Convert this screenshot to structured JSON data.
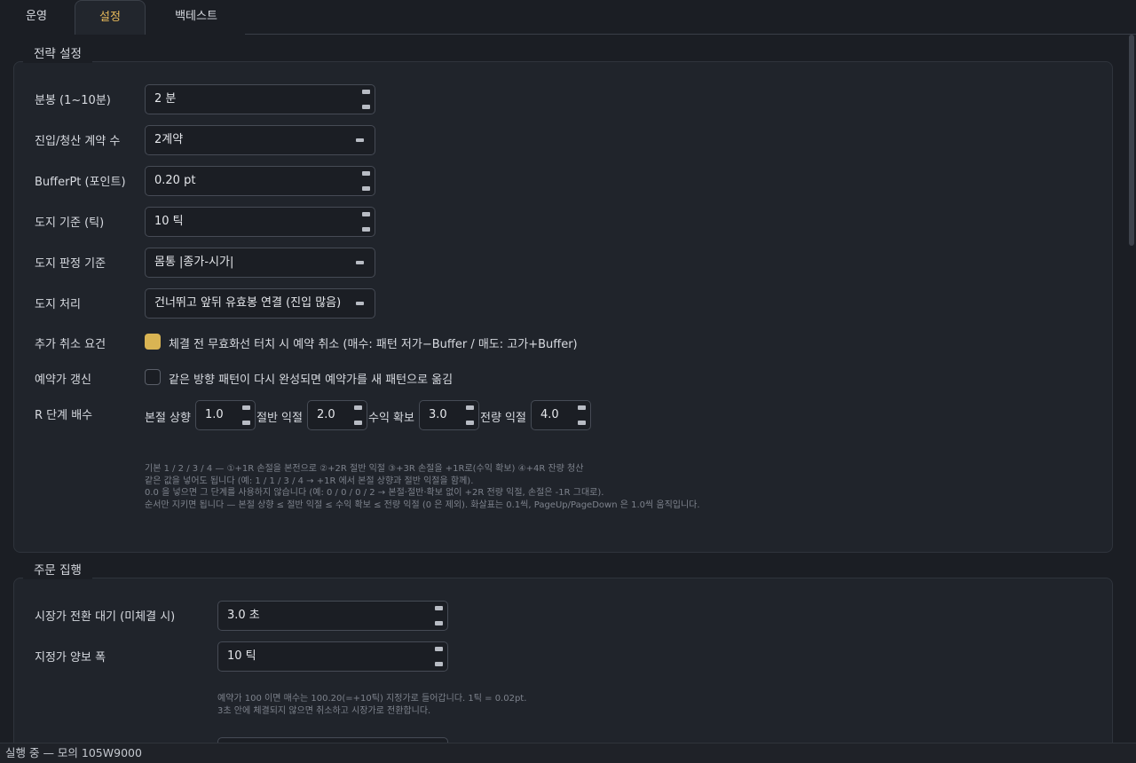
{
  "tabs": [
    {
      "label": "운영"
    },
    {
      "label": "설정"
    },
    {
      "label": "백테스트"
    }
  ],
  "strategy": {
    "title": "전략 설정",
    "bar": {
      "label": "분봉 (1~10분)",
      "value": "2 분"
    },
    "contracts": {
      "label": "진입/청산 계약 수",
      "value": "2계약"
    },
    "buffer": {
      "label": "BufferPt (포인트)",
      "value": "0.20 pt"
    },
    "doji_ticks": {
      "label": "도지 기준 (틱)",
      "value": "10 틱"
    },
    "doji_basis": {
      "label": "도지 판정 기준",
      "value": "몸통 |종가-시가|"
    },
    "doji_handling": {
      "label": "도지 처리",
      "value": "건너뛰고 앞뒤 유효봉 연결 (진입 많음)"
    },
    "cancel": {
      "label": "추가 취소 요건",
      "checked": true,
      "text": "체결 전 무효화선 터치 시 예약 취소 (매수: 패턴 저가−Buffer / 매도: 고가+Buffer)"
    },
    "refresh": {
      "label": "예약가 갱신",
      "checked": false,
      "text": "같은 방향 패턴이 다시 완성되면 예약가를 새 패턴으로 옮김"
    },
    "r_steps": {
      "label": "R 단계 배수",
      "items": [
        {
          "name": "본절 상향",
          "value": "1.0"
        },
        {
          "name": "절반 익절",
          "value": "2.0"
        },
        {
          "name": "수익 확보",
          "value": "3.0"
        },
        {
          "name": "전량 익절",
          "value": "4.0"
        }
      ]
    },
    "hint_lines": [
      "기본 1 / 2 / 3 / 4 — ①+1R 손절을 본전으로 ②+2R 절반 익절 ③+3R 손절을 +1R로(수익 확보) ④+4R 잔량 청산",
      "같은 값을 넣어도 됩니다 (예: 1 / 1 / 3 / 4 → +1R 에서 본절 상향과 절반 익절을 함께).",
      "0.0 을 넣으면 그 단계를 사용하지 않습니다 (예: 0 / 0 / 0 / 2 → 본절·절반·확보 없이 +2R 전량 익절, 손절은 -1R 그대로).",
      "순서만 지키면 됩니다 — 본절 상향 ≤ 절반 익절 ≤ 수익 확보 ≤ 전량 익절 (0 은 제외). 화살표는 0.1씩, PageUp/PageDown 은 1.0씩 움직입니다."
    ]
  },
  "order": {
    "title": "주문 집행",
    "market_wait": {
      "label": "시장가 전환 대기 (미체결 시)",
      "value": "3.0 초"
    },
    "limit_offset": {
      "label": "지정가 양보 폭",
      "value": "10 틱"
    },
    "hint_lines": [
      "예약가 100 이면 매수는 100.20(=+10틱) 지정가로 들어갑니다. 1틱 = 0.02pt.",
      "3초 안에 체결되지 않으면 취소하고 시장가로 전환합니다."
    ]
  },
  "status": {
    "text": "실행 중 — 모의 105W9000"
  },
  "colors": {
    "accent": "#e6b95a",
    "checkbox_on": "#d9b453",
    "background": "#1b1e24"
  }
}
